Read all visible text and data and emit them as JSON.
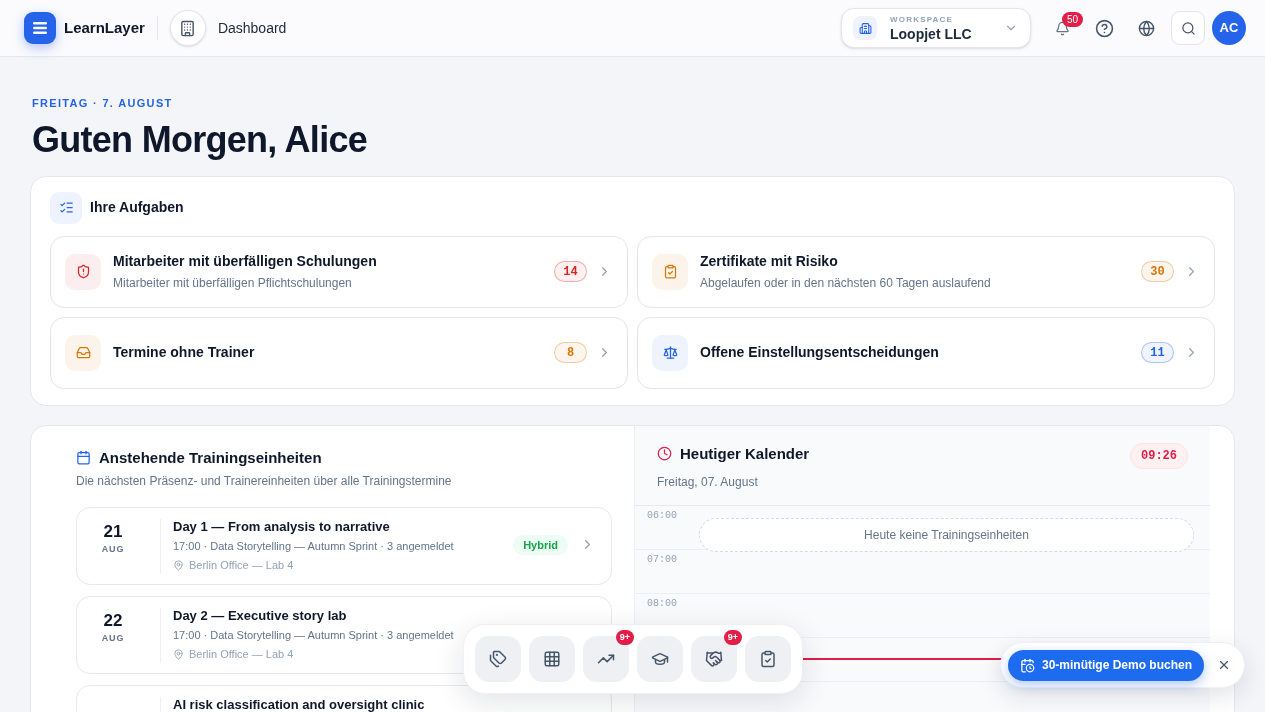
{
  "header": {
    "brand": "LearnLayer",
    "page": "Dashboard",
    "workspace": {
      "label": "WORKSPACE",
      "name": "Loopjet LLC"
    },
    "notifications": "50",
    "avatar": "AC"
  },
  "greeting": {
    "date": "FREITAG · 7. AUGUST",
    "title": "Guten Morgen, Alice"
  },
  "tasks": {
    "title": "Ihre Aufgaben",
    "items": [
      {
        "title": "Mitarbeiter mit überfälligen Schulungen",
        "subtitle": "Mitarbeiter mit überfälligen Pflichtschulungen",
        "count": "14",
        "color": "#dc2626"
      },
      {
        "title": "Zertifikate mit Risiko",
        "subtitle": "Abgelaufen oder in den nächsten 60 Tagen auslaufend",
        "count": "30",
        "color": "#d97706"
      },
      {
        "title": "Termine ohne Trainer",
        "count": "8",
        "color": "#d97706"
      },
      {
        "title": "Offene Einstellungsentscheidungen",
        "count": "11",
        "color": "#2563eb"
      }
    ]
  },
  "sessions": {
    "title": "Anstehende Trainingseinheiten",
    "subtitle": "Die nächsten Präsenz- und Trainereinheiten über alle Trainingstermine",
    "items": [
      {
        "day": "21",
        "month": "AUG",
        "title": "Day 1 — From analysis to narrative",
        "meta": "17:00 · Data Storytelling — Autumn Sprint · 3 angemeldet",
        "location": "Berlin Office — Lab 4",
        "tag": "Hybrid"
      },
      {
        "day": "22",
        "month": "AUG",
        "title": "Day 2 — Executive story lab",
        "meta": "17:00 · Data Storytelling — Autumn Sprint · 3 angemeldet",
        "location": "Berlin Office — Lab 4"
      },
      {
        "title": "AI risk classification and oversight clinic"
      }
    ]
  },
  "calendar": {
    "title": "Heutiger Kalender",
    "date": "Freitag, 07. August",
    "now": "09:26",
    "hours": [
      "06:00",
      "07:00",
      "08:00"
    ],
    "empty": "Heute keine Trainingseinheiten"
  },
  "dock": [
    {
      "kind": "tags"
    },
    {
      "kind": "grid"
    },
    {
      "kind": "trend",
      "badge": "9+"
    },
    {
      "kind": "cap"
    },
    {
      "kind": "handshake",
      "badge": "9+"
    },
    {
      "kind": "clipboard"
    }
  ],
  "demo": {
    "label": "30-minütige Demo buchen"
  }
}
